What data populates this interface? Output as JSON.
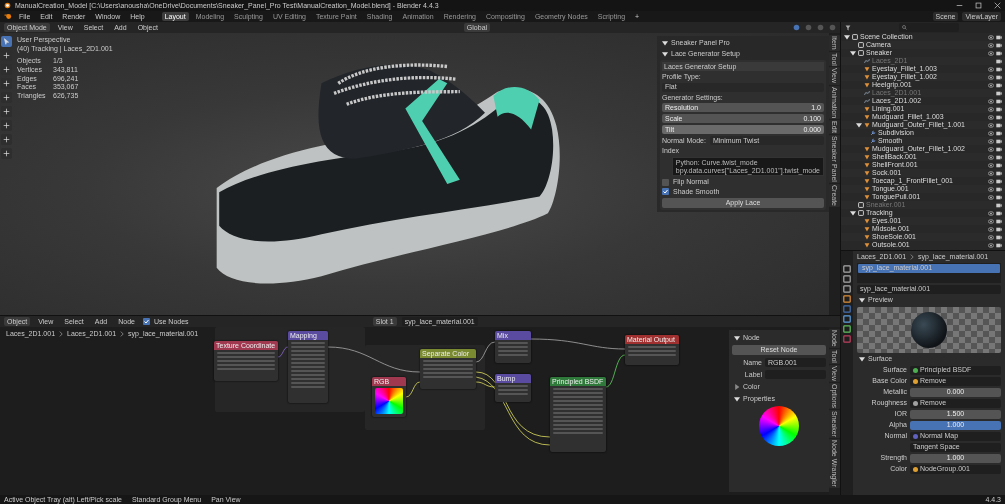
{
  "window": {
    "title": "ManualCreation_Model [C:\\Users\\anousha\\OneDrive\\Documents\\Sneaker_Panel_Pro Test\\ManualCreation_Model.blend] - Blender 4.4.3"
  },
  "menu": [
    "File",
    "Edit",
    "Render",
    "Window",
    "Help"
  ],
  "workspaces": [
    {
      "label": "Layout",
      "selected": true
    },
    {
      "label": "Modeling",
      "selected": false
    },
    {
      "label": "Sculpting",
      "selected": false
    },
    {
      "label": "UV Editing",
      "selected": false
    },
    {
      "label": "Texture Paint",
      "selected": false
    },
    {
      "label": "Shading",
      "selected": false
    },
    {
      "label": "Animation",
      "selected": false
    },
    {
      "label": "Rendering",
      "selected": false
    },
    {
      "label": "Compositing",
      "selected": false
    },
    {
      "label": "Geometry Nodes",
      "selected": false
    },
    {
      "label": "Scripting",
      "selected": false
    }
  ],
  "add_workspace": "+",
  "scene": "Scene",
  "view_layer": "ViewLayer",
  "viewport": {
    "mode": "Object Mode",
    "menus": [
      "View",
      "Select",
      "Add",
      "Object"
    ],
    "orientation": "Global",
    "view": "User Perspective",
    "context": "(40) Tracking | Laces_2D1.001",
    "stats": [
      {
        "label": "Objects",
        "value": "1/3"
      },
      {
        "label": "Vertices",
        "value": "343,811"
      },
      {
        "label": "Edges",
        "value": "696,241"
      },
      {
        "label": "Faces",
        "value": "353,067"
      },
      {
        "label": "Triangles",
        "value": "626,735"
      }
    ],
    "tools": [
      {
        "selected": true
      },
      {
        "selected": false
      },
      {
        "selected": false
      },
      {
        "selected": false
      },
      {
        "selected": false
      },
      {
        "selected": false
      },
      {
        "selected": false
      },
      {
        "selected": false
      },
      {
        "selected": false
      }
    ]
  },
  "n_panel": {
    "addon": "Sneaker Panel Pro",
    "subpanel": "Lace Generator Setup",
    "section": "Laces Generator Setup",
    "profile_label": "Profile Type:",
    "profile": "Flat",
    "settings_label": "Generator Settings:",
    "settings": [
      {
        "label": "Resolution",
        "value": "1.0",
        "selected": false
      },
      {
        "label": "Scale",
        "value": "0.100",
        "selected": false
      },
      {
        "label": "Tilt",
        "value": "0.000",
        "selected": true
      }
    ],
    "normal_mode_label": "Normal Mode:",
    "normal_mode": "Minimum Twist",
    "index_label": "Index",
    "tooltip": [
      "Python: Curve.twist_mode",
      "bpy.data.curves[\"Laces_2D1.001\"].twist_mode"
    ],
    "options": [
      {
        "label": "Flip Normal",
        "checked": false
      },
      {
        "label": "Shade Smooth",
        "checked": true
      }
    ],
    "apply": "Apply Lace",
    "tabs": [
      "Item",
      "Tool",
      "View",
      "Animation",
      "Edit",
      "Sneaker Panel",
      "Create"
    ]
  },
  "outliner": {
    "items": [
      {
        "label": "Scene Collection",
        "kind": "collection",
        "hidden": false,
        "expanded": true,
        "children": [
          {
            "label": "Camera",
            "kind": "collection",
            "hidden": false
          },
          {
            "label": "Sneaker",
            "kind": "collection",
            "hidden": false,
            "expanded": true,
            "children": [
              {
                "label": "Laces_2D1",
                "kind": "curve",
                "hidden": true
              },
              {
                "label": "Eyestay_Fillet_1.003",
                "kind": "mesh",
                "hidden": false
              },
              {
                "label": "Eyestay_Fillet_1.002",
                "kind": "mesh",
                "hidden": false
              },
              {
                "label": "Heelgrip.001",
                "kind": "mesh",
                "hidden": false
              },
              {
                "label": "Laces_2D1.001",
                "kind": "curve",
                "hidden": true
              },
              {
                "label": "Laces_2D1.002",
                "kind": "curve",
                "hidden": false
              },
              {
                "label": "Lining.001",
                "kind": "mesh",
                "hidden": false
              },
              {
                "label": "Mudguard_Fillet_1.003",
                "kind": "mesh",
                "hidden": false
              },
              {
                "label": "Mudguard_Outer_Fillet_1.001",
                "kind": "mesh",
                "hidden": false,
                "expanded": true,
                "children": [
                  {
                    "label": "Subdivision",
                    "kind": "modifier",
                    "hidden": false
                  },
                  {
                    "label": "Smooth",
                    "kind": "modifier",
                    "hidden": false
                  }
                ]
              },
              {
                "label": "Mudguard_Outer_Fillet_1.002",
                "kind": "mesh",
                "hidden": false
              },
              {
                "label": "ShellBack.001",
                "kind": "mesh",
                "hidden": false
              },
              {
                "label": "ShellFront.001",
                "kind": "mesh",
                "hidden": false
              },
              {
                "label": "Sock.001",
                "kind": "mesh",
                "hidden": false
              },
              {
                "label": "Toecap_1_FrontFillet_001",
                "kind": "mesh",
                "hidden": false
              },
              {
                "label": "Tongue.001",
                "kind": "mesh",
                "hidden": false
              },
              {
                "label": "TonguePull.001",
                "kind": "mesh",
                "hidden": false
              }
            ]
          },
          {
            "label": "Sneaker.001",
            "kind": "collection",
            "hidden": true
          },
          {
            "label": "Tracking",
            "kind": "collection",
            "hidden": false,
            "expanded": true,
            "children": [
              {
                "label": "Eyes.001",
                "kind": "mesh",
                "hidden": false
              },
              {
                "label": "Midsole.001",
                "kind": "mesh",
                "hidden": false
              },
              {
                "label": "ShoeSole.001",
                "kind": "mesh",
                "hidden": false
              },
              {
                "label": "Outsole.001",
                "kind": "mesh",
                "hidden": false
              }
            ]
          }
        ]
      }
    ]
  },
  "properties": {
    "object": "Laces_2D1.001",
    "material": "syp_lace_material.001",
    "slots": [
      {
        "label": "syp_lace_material.001",
        "selected": true
      }
    ],
    "material_name": "syp_lace_material.001",
    "preview_label": "Preview",
    "surface_label": "Surface",
    "fields": [
      {
        "label": "Surface",
        "kind": "link",
        "value": "Principled BSDF",
        "color": "#4caf50",
        "selected": false
      },
      {
        "label": "Base Color",
        "kind": "link",
        "value": "Remove",
        "color": "#e0a030",
        "selected": false
      },
      {
        "label": "Metallic",
        "kind": "number",
        "value": "0.000",
        "selected": false
      },
      {
        "label": "Roughness",
        "kind": "link",
        "value": "Remove",
        "color": "#a0a0a0",
        "selected": false
      },
      {
        "label": "IOR",
        "kind": "number",
        "value": "1.500",
        "selected": false
      },
      {
        "label": "Alpha",
        "kind": "number",
        "value": "1.000",
        "selected": true
      },
      {
        "label": "Normal",
        "kind": "link",
        "value": "Normal Map",
        "color": "#6060c0",
        "selected": false
      },
      {
        "kind": "dropdown",
        "value": "Tangent Space",
        "selected": false
      },
      {
        "label": "Strength",
        "kind": "number",
        "value": "1.000",
        "selected": false
      },
      {
        "label": "Color",
        "kind": "link",
        "value": "NodeGroup.001",
        "color": "#e0a030",
        "selected": false
      }
    ]
  },
  "node_editor": {
    "mode": "Object",
    "menus": [
      "View",
      "Select",
      "Add",
      "Node"
    ],
    "use_nodes": {
      "label": "Use Nodes",
      "checked": true
    },
    "slot": "Slot 1",
    "material": "syp_lace_material.001",
    "breadcrumb": [
      "Laces_2D1.001",
      "Laces_2D1.001",
      "syp_lace_material.001"
    ],
    "nodes": [
      {
        "title": "Texture Coordinate",
        "color": "#a03850"
      },
      {
        "title": "Mapping",
        "color": "#5a4aa0"
      },
      {
        "title": "RGB",
        "color": "#a03850"
      },
      {
        "title": "Separate Color",
        "color": "#7a8a30"
      },
      {
        "title": "Mix",
        "color": "#5a4aa0"
      },
      {
        "title": "Bump",
        "color": "#5a4aa0"
      },
      {
        "title": "Principled BSDF",
        "color": "#2f7a3a"
      },
      {
        "title": "Material Output",
        "color": "#a03030"
      }
    ],
    "sidebar": {
      "section": "Node",
      "reset": "Reset Node",
      "name_label": "Name",
      "name": "RGB.001",
      "label_label": "Label",
      "color_label": "Color",
      "properties_label": "Properties"
    },
    "tabs": [
      "Node",
      "Tool",
      "View",
      "Options",
      "Sneaker",
      "Node Wrangler"
    ]
  },
  "status": {
    "hints": [
      "Active Object Tray (alt) Left/Pick scale",
      "Standard Group Menu",
      "Pan View"
    ],
    "version": "4.4.3"
  }
}
